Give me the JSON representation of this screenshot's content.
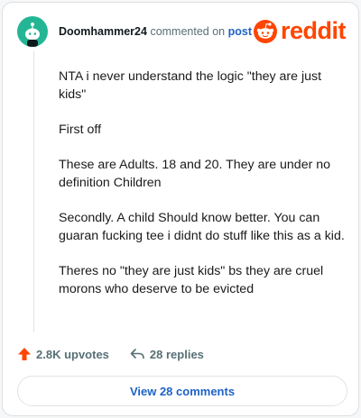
{
  "header": {
    "username": "Doomhammer24",
    "action_text": "commented on",
    "post_link": "post",
    "logo_text": "reddit"
  },
  "comment": {
    "paragraphs": [
      "NTA i never understand the logic \"they are just kids\"",
      "First off",
      "These are Adults. 18 and 20. They are under no definition Children",
      "Secondly. A child Should know better. You can guaran fucking tee i didnt do stuff like this as a kid.",
      "Theres no \"they are just kids\" bs they are cruel morons who deserve to be evicted"
    ]
  },
  "actions": {
    "upvotes": "2.8K upvotes",
    "replies": "28 replies"
  },
  "view_comments_label": "View 28 comments",
  "colors": {
    "brand": "#ff4500",
    "avatar": "#24b694",
    "link": "#1f62c7"
  },
  "icons": [
    "avatar-snoo-icon",
    "reddit-snoo-icon",
    "upvote-arrow-icon",
    "reply-arrow-icon"
  ]
}
